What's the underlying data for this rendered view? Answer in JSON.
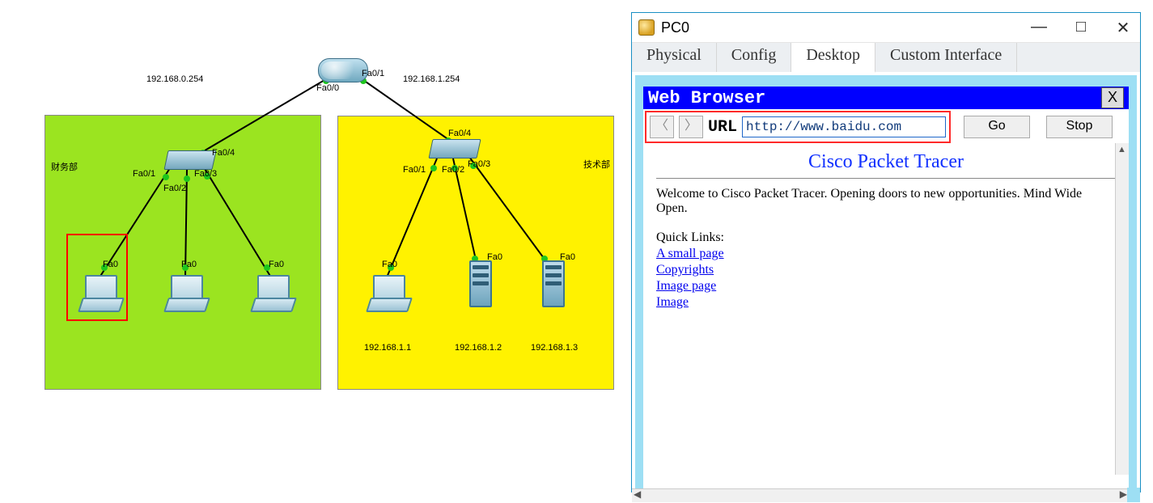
{
  "topology": {
    "zones": {
      "green": {
        "label": "财务部"
      },
      "yellow": {
        "label": "技术部"
      }
    },
    "gateways": {
      "left": "192.168.0.254",
      "right": "192.168.1.254"
    },
    "router_ports": {
      "p0": "Fa0/0",
      "p1": "Fa0/1"
    },
    "switch_left": {
      "p1": "Fa0/1",
      "p2": "Fa0/2",
      "p3": "Fa0/3",
      "p4": "Fa0/4"
    },
    "switch_right": {
      "p1": "Fa0/1",
      "p2": "Fa0/2",
      "p3": "Fa0/3",
      "p4": "Fa0/4"
    },
    "host_if": "Fa0",
    "right_ips": {
      "h1": "192.168.1.1",
      "h2": "192.168.1.2",
      "h3": "192.168.1.3"
    }
  },
  "window": {
    "title": "PC0",
    "tabs": {
      "physical": "Physical",
      "config": "Config",
      "desktop": "Desktop",
      "custom": "Custom Interface"
    },
    "controls": {
      "min": "—",
      "max": "□",
      "close": "✕"
    }
  },
  "browser": {
    "title": "Web Browser",
    "close": "X",
    "back": "〈",
    "forward": "〉",
    "url_label": "URL",
    "url_value": "http://www.baidu.com",
    "go": "Go",
    "stop": "Stop",
    "page": {
      "heading": "Cisco Packet Tracer",
      "body": "Welcome to Cisco Packet Tracer. Opening doors to new opportunities. Mind Wide Open.",
      "links_label": "Quick Links:",
      "links": {
        "l1": "A small page",
        "l2": "Copyrights",
        "l3": "Image page",
        "l4": "Image"
      }
    }
  }
}
